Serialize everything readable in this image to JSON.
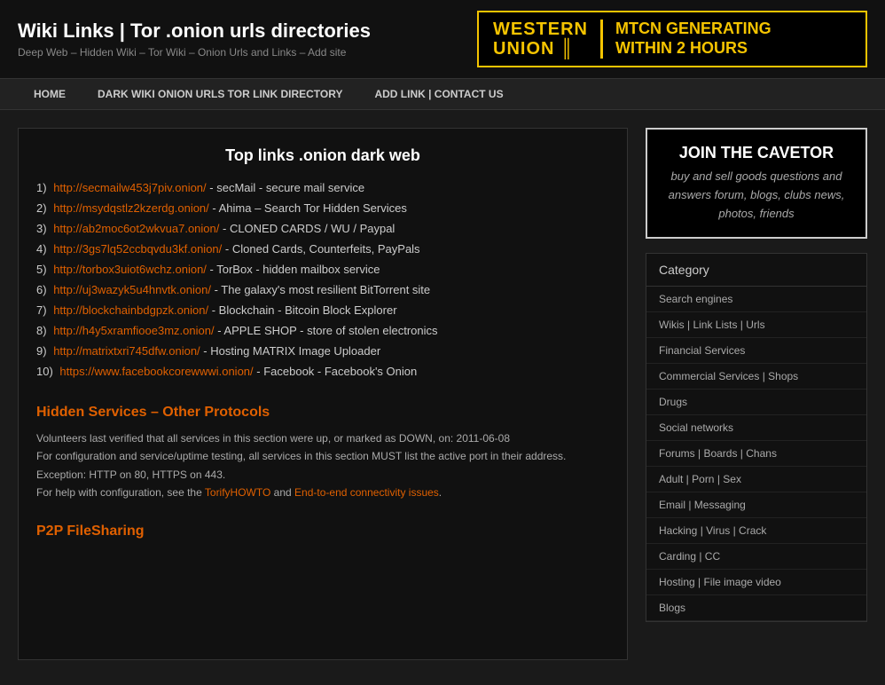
{
  "header": {
    "title": "Wiki Links | Tor .onion urls directories",
    "subtitle": "Deep Web – Hidden Wiki – Tor Wiki – Onion Urls and Links – Add site",
    "banner": {
      "wu_text": "WESTERN\nUNION",
      "banner_text": "MTCN GENERATING\nWITHIN 2 HOURS"
    }
  },
  "nav": {
    "items": [
      {
        "label": "HOME",
        "href": "#"
      },
      {
        "label": "DARK WIKI ONION URLS TOR LINK DIRECTORY",
        "href": "#"
      },
      {
        "label": "ADD LINK | CONTACT US",
        "href": "#"
      }
    ]
  },
  "content": {
    "main_title": "Top links .onion dark web",
    "links": [
      {
        "num": "1)",
        "url": "http://secmailw453j7piv.onion/",
        "desc": "- secMail - secure mail service"
      },
      {
        "num": "2)",
        "url": "http://msydqstlz2kzerdg.onion/",
        "desc": "- Ahima – Search Tor Hidden Services"
      },
      {
        "num": "3)",
        "url": "http://ab2moc6ot2wkvua7.onion/",
        "desc": "- CLONED CARDS / WU / Paypal"
      },
      {
        "num": "4)",
        "url": "http://3gs7lq52ccbqvdu3kf.onion/",
        "desc": "- Cloned Cards, Counterfeits, PayPals"
      },
      {
        "num": "5)",
        "url": "http://torbox3uiot6wchz.onion/",
        "desc": "- TorBox - hidden mailbox service"
      },
      {
        "num": "6)",
        "url": "http://uj3wazyk5u4hnvtk.onion/",
        "desc": "- The galaxy's most resilient BitTorrent site"
      },
      {
        "num": "7)",
        "url": "http://blockchainbdgpzk.onion/",
        "desc": "- Blockchain - Bitcoin Block Explorer"
      },
      {
        "num": "8)",
        "url": "http://h4y5xramfiooe3mz.onion/",
        "desc": "- APPLE SHOP - store of stolen electronics"
      },
      {
        "num": "9)",
        "url": "http://matrixtxri745dfw.onion/",
        "desc": "- Hosting MATRIX Image Uploader"
      },
      {
        "num": "10)",
        "url": "https://www.facebookcorewwwi.onion/",
        "desc": "- Facebook - Facebook's Onion"
      }
    ],
    "hidden_services": {
      "title": "Hidden Services – Other Protocols",
      "para1": "Volunteers last verified that all services in this section were up, or marked as DOWN, on: 2011-06-08",
      "para2": "For configuration and service/uptime testing, all services in this section MUST list the active port in their address. Exception: HTTP on 80, HTTPS on 443.",
      "para3_prefix": "For help with configuration, see the ",
      "link1_text": "TorifyHOWTO",
      "para3_mid": " and ",
      "link2_text": "End-to-end connectivity issues",
      "para3_suffix": "."
    },
    "p2p": {
      "title": "P2P FileSharing"
    }
  },
  "sidebar": {
    "cavetor": {
      "title": "JOIN THE CAVETOR",
      "desc": "buy and sell goods questions and answers forum, blogs, clubs news, photos, friends"
    },
    "category": {
      "title": "Category",
      "items": [
        "Search engines",
        "Wikis | Link Lists | Urls",
        "Financial Services",
        "Commercial Services | Shops",
        "Drugs",
        "Social networks",
        "Forums | Boards | Chans",
        "Adult | Porn | Sex",
        "Email | Messaging",
        "Hacking | Virus | Crack",
        "Carding | CC",
        "Hosting | File image video",
        "Blogs"
      ]
    }
  }
}
